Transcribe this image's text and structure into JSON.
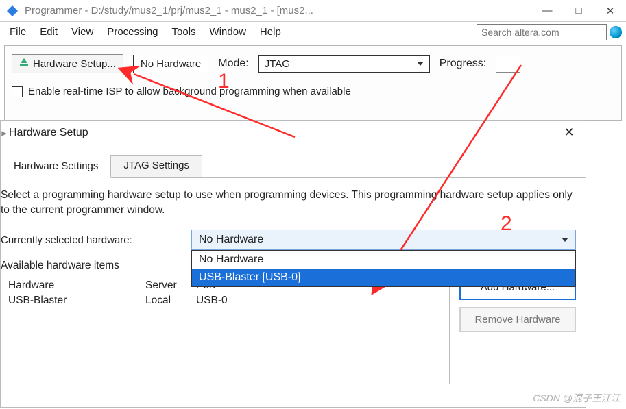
{
  "window": {
    "title": "Programmer - D:/study/mus2_1/prj/mus2_1 - mus2_1 - [mus2...",
    "min": "—",
    "max": "□",
    "close": "✕"
  },
  "menu": {
    "file": "File",
    "edit": "Edit",
    "view": "View",
    "processing": "Processing",
    "tools": "Tools",
    "window": "Window",
    "help": "Help",
    "search_placeholder": "Search altera.com"
  },
  "toolbar": {
    "hw_setup": "Hardware Setup...",
    "no_hw": "No Hardware",
    "mode_label": "Mode:",
    "mode_value": "JTAG",
    "progress_label": "Progress:",
    "enable_isp": "Enable real-time ISP to allow background programming when available"
  },
  "dialog": {
    "title": "Hardware Setup",
    "tabs": {
      "hw": "Hardware Settings",
      "jtag": "JTAG Settings"
    },
    "description": "Select a programming hardware setup to use when programming devices. This programming hardware setup applies only to the current programmer window.",
    "selected_label": "Currently selected hardware:",
    "selected_value": "No Hardware",
    "options": {
      "o1": "No Hardware",
      "o2": "USB-Blaster [USB-0]"
    },
    "available_label": "Available hardware items",
    "table": {
      "h1": "Hardware",
      "h2": "Server",
      "h3": "Port",
      "r1c1": "USB-Blaster",
      "r1c2": "Local",
      "r1c3": "USB-0"
    },
    "add_btn": "Add Hardware...",
    "remove_btn": "Remove Hardware"
  },
  "annotations": {
    "one": "1",
    "two": "2"
  },
  "watermark": "CSDN @混子王江江"
}
